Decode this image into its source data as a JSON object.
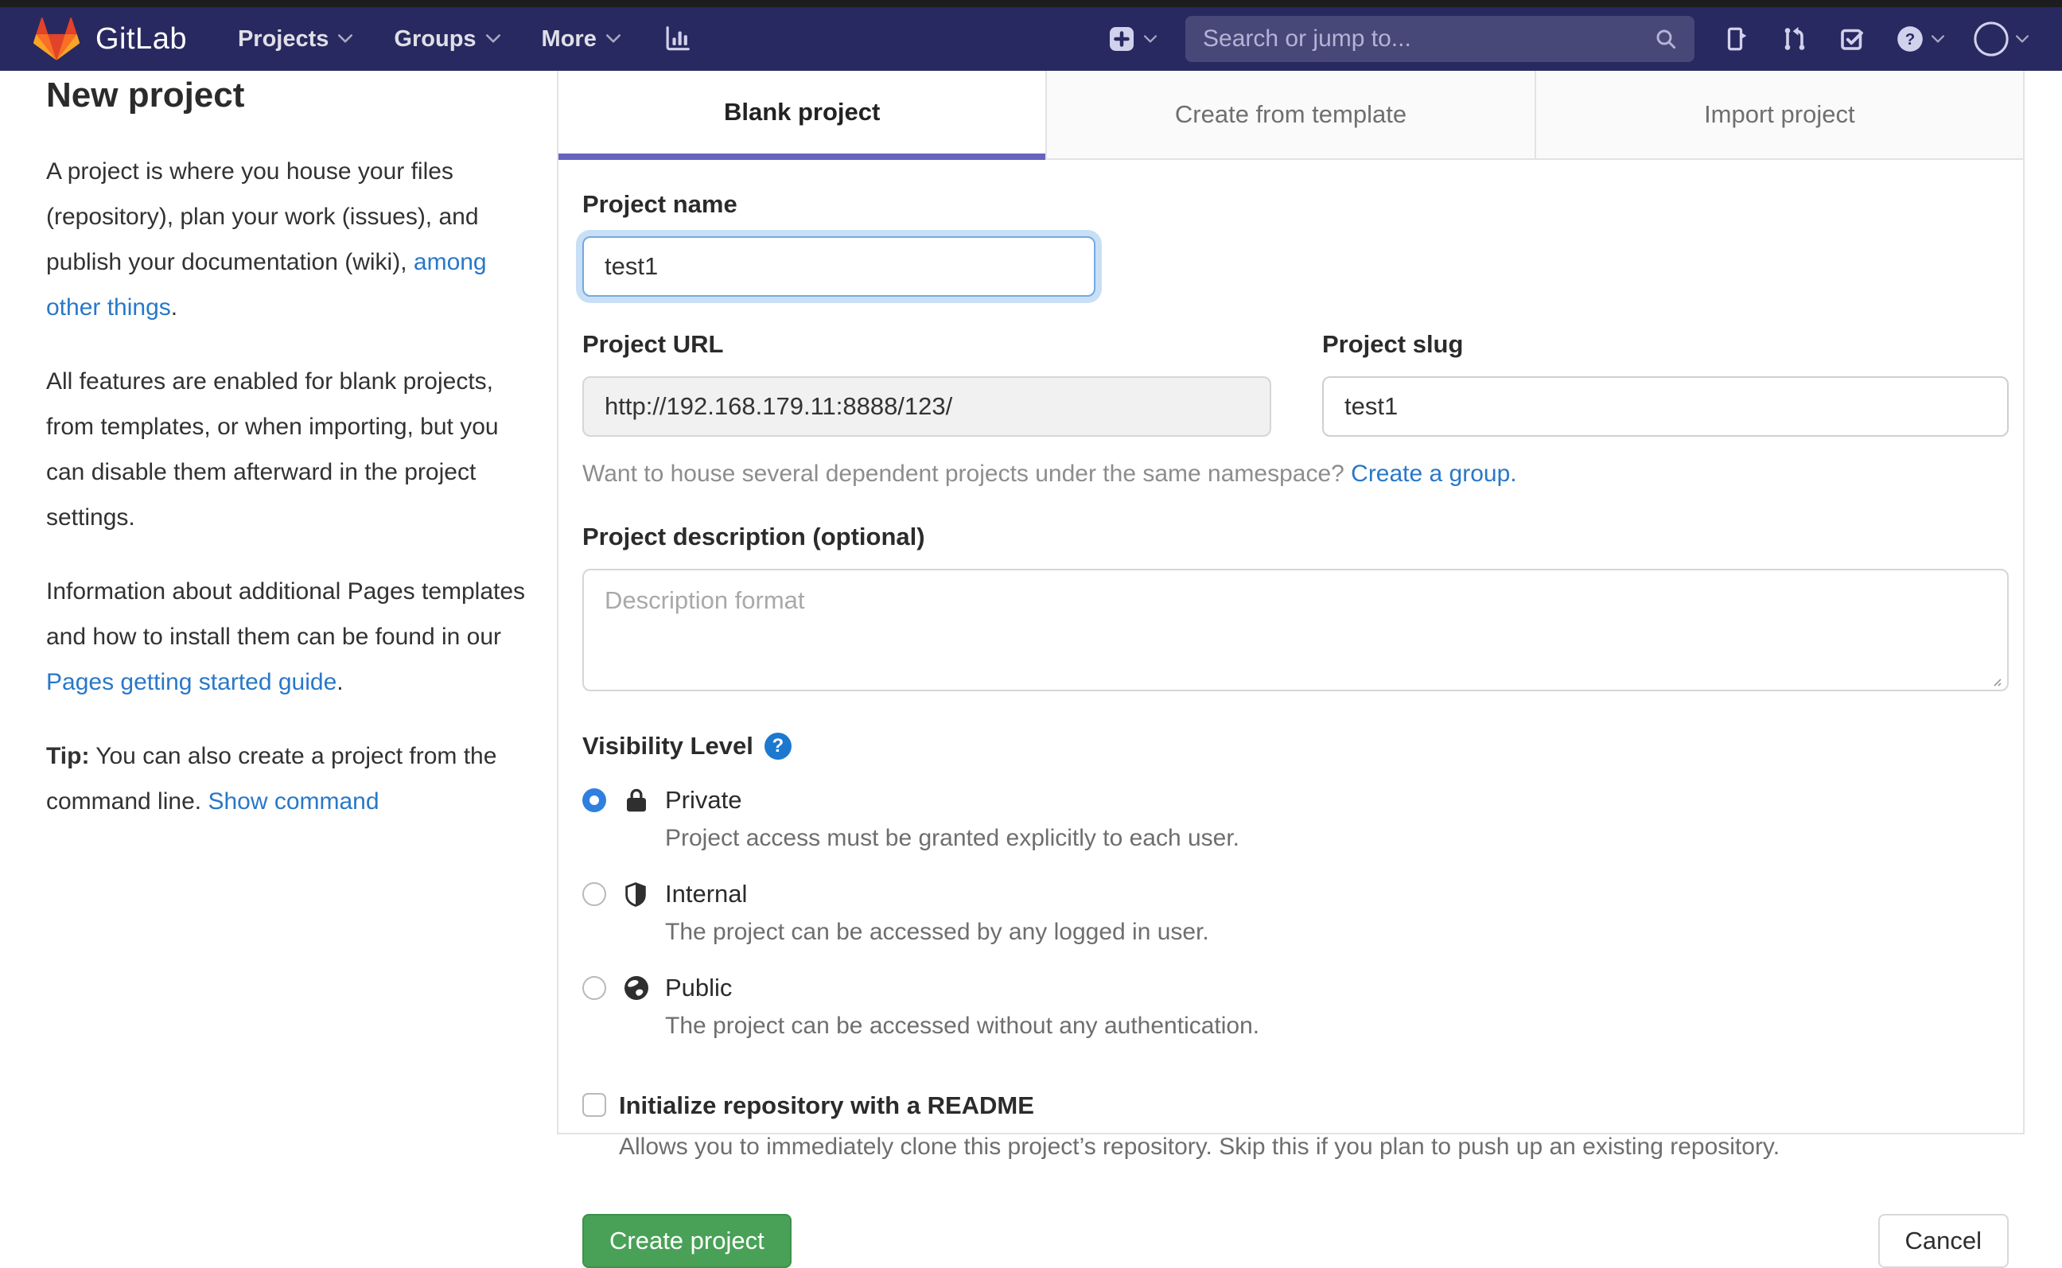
{
  "navbar": {
    "logo_text": "GitLab",
    "menus": [
      {
        "label": "Projects"
      },
      {
        "label": "Groups"
      },
      {
        "label": "More"
      }
    ],
    "search_placeholder": "Search or jump to...",
    "icons": [
      "bar-chart-icon",
      "plus-icon",
      "search-icon",
      "issues-icon",
      "merge-request-icon",
      "todo-icon",
      "help-icon",
      "avatar"
    ]
  },
  "sidebar": {
    "title": "New project",
    "p1_pre": "A project is where you house your files (repository), plan your work (issues), and publish your documentation (wiki), ",
    "p1_link": "among other things",
    "p1_post": ".",
    "p2": "All features are enabled for blank projects, from templates, or when importing, but you can disable them afterward in the project settings.",
    "p3_pre": "Information about additional Pages templates and how to install them can be found in our ",
    "p3_link": "Pages getting started guide",
    "p3_post": ".",
    "tip_label": "Tip:",
    "tip_text": " You can also create a project from the command line. ",
    "tip_link": "Show command"
  },
  "tabs": [
    {
      "label": "Blank project",
      "active": true
    },
    {
      "label": "Create from template",
      "active": false
    },
    {
      "label": "Import project",
      "active": false
    }
  ],
  "form": {
    "project_name": {
      "label": "Project name",
      "value": "test1"
    },
    "project_url": {
      "label": "Project URL",
      "value": "http://192.168.179.11:8888/123/"
    },
    "project_slug": {
      "label": "Project slug",
      "value": "test1"
    },
    "namespace_hint": "Want to house several dependent projects under the same namespace? ",
    "namespace_link": "Create a group.",
    "description": {
      "label": "Project description (optional)",
      "placeholder": "Description format"
    },
    "visibility": {
      "label": "Visibility Level",
      "options": [
        {
          "name": "Private",
          "desc": "Project access must be granted explicitly to each user.",
          "selected": true
        },
        {
          "name": "Internal",
          "desc": "The project can be accessed by any logged in user.",
          "selected": false
        },
        {
          "name": "Public",
          "desc": "The project can be accessed without any authentication.",
          "selected": false
        }
      ]
    },
    "readme": {
      "label": "Initialize repository with a README",
      "desc": "Allows you to immediately clone this project’s repository. Skip this if you plan to push up an existing repository.",
      "checked": false
    },
    "submit_label": "Create project",
    "cancel_label": "Cancel"
  },
  "colors": {
    "navbar_bg": "#292961",
    "accent_indigo": "#6663c0",
    "link_blue": "#2878c8",
    "radio_blue": "#2e7fe0",
    "green": "#49a157",
    "green_border": "#3f9149"
  }
}
